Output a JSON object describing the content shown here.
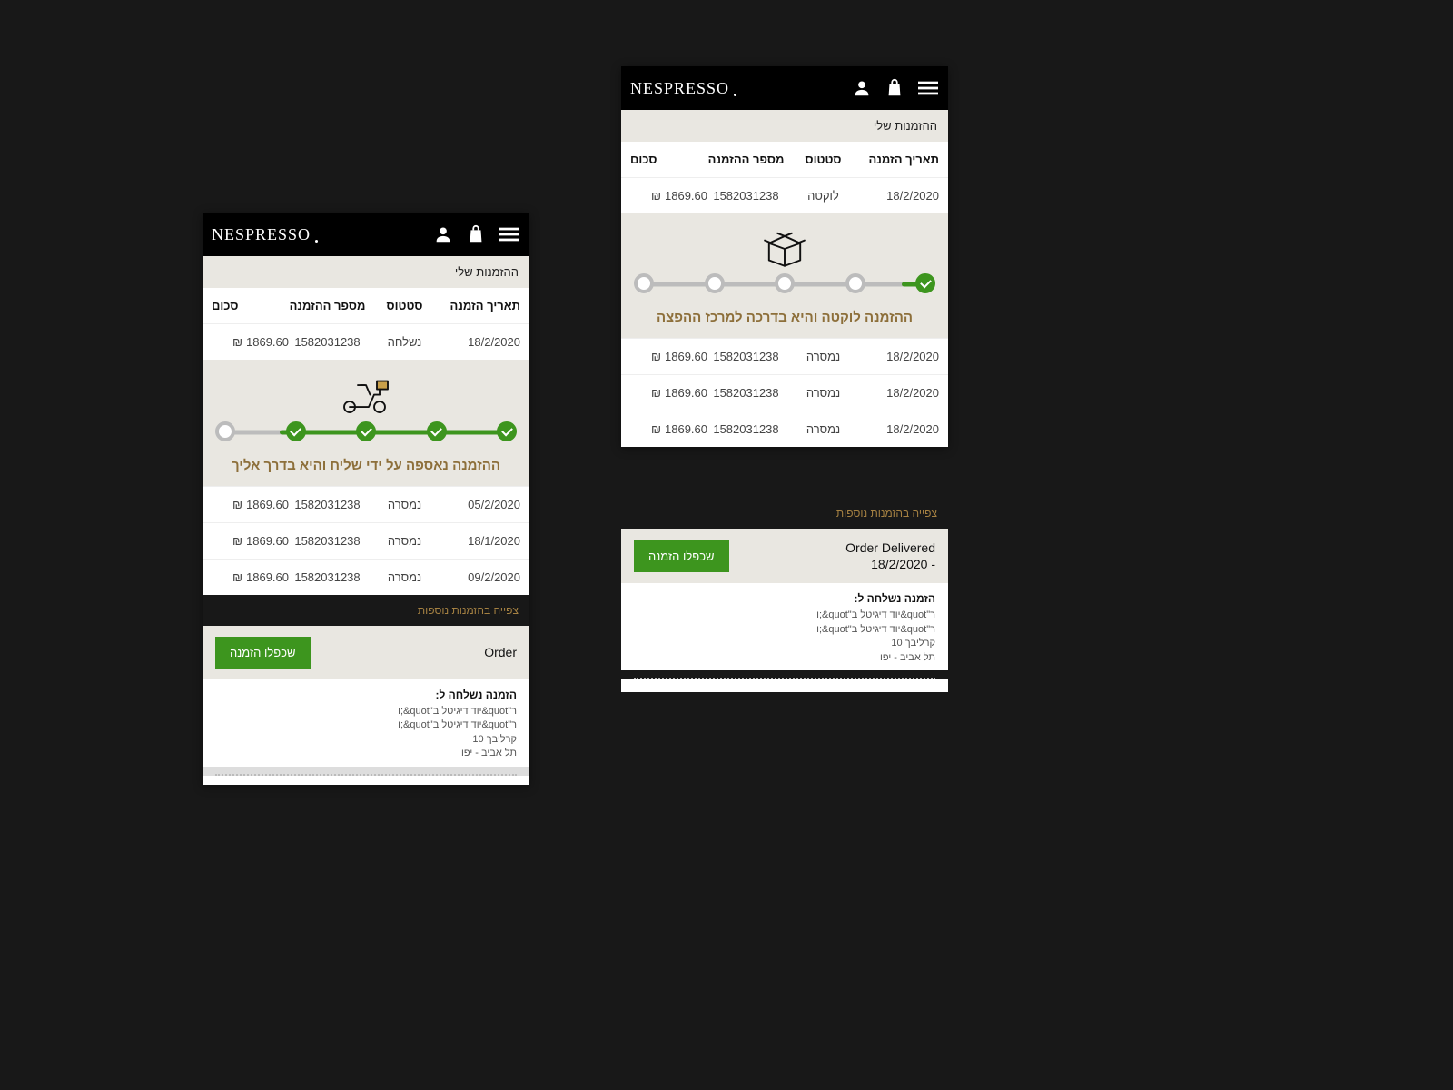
{
  "logo": "NESPRESSO",
  "my_orders_title": "ההזמנות שלי",
  "more_link": "צפייה בהזמנות נוספות",
  "duplicate_btn": "שכפלו הזמנה",
  "currency": "₪",
  "columns": {
    "date": "תאריך הזמנה",
    "status": "סטטוס",
    "number": "מספר ההזמנה",
    "amount": "סכום"
  },
  "address": {
    "head": "הזמנה נשלחה ל:",
    "l1": "ר\"quot&יוד דיגיטל ב\"quot&;ו",
    "l2": "ר\"quot&יוד דיגיטל ב\"quot&;ו",
    "l3": "קרליבך 10",
    "l4": "תל אביב - יפו"
  },
  "phoneA": {
    "main_row": {
      "date": "18/2/2020",
      "status": "נשלחה",
      "number": "1582031238",
      "amount": "1869.60"
    },
    "status_text": "ההזמנה נאספה על ידי שליח והיא בדרך אליך",
    "rows": [
      {
        "date": "05/2/2020",
        "status": "נמסרה",
        "number": "1582031238",
        "amount": "1869.60"
      },
      {
        "date": "18/1/2020",
        "status": "נמסרה",
        "number": "1582031238",
        "amount": "1869.60"
      },
      {
        "date": "09/2/2020",
        "status": "נמסרה",
        "number": "1582031238",
        "amount": "1869.60"
      }
    ],
    "order_title": "Order"
  },
  "phoneB": {
    "main_row": {
      "date": "18/2/2020",
      "status": "לוקטה",
      "number": "1582031238",
      "amount": "1869.60"
    },
    "status_text": "ההזמנה לוקטה והיא בדרכה למרכז ההפצה",
    "rows": [
      {
        "date": "18/2/2020",
        "status": "נמסרה",
        "number": "1582031238",
        "amount": "1869.60"
      },
      {
        "date": "18/2/2020",
        "status": "נמסרה",
        "number": "1582031238",
        "amount": "1869.60"
      },
      {
        "date": "18/2/2020",
        "status": "נמסרה",
        "number": "1582031238",
        "amount": "1869.60"
      }
    ],
    "order_title": "Order Delivered\n- 18/2/2020"
  }
}
